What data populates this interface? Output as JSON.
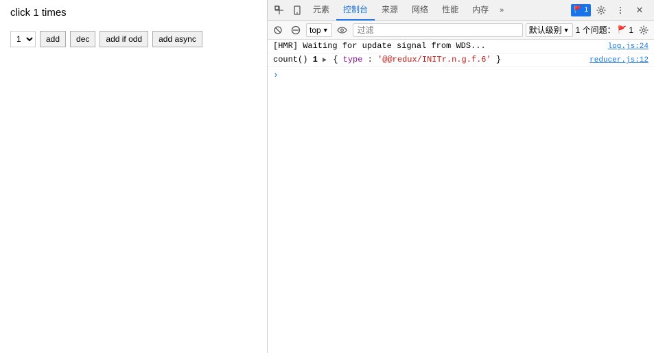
{
  "left": {
    "title": "click 1 times",
    "select_value": "1",
    "buttons": [
      {
        "label": "add",
        "name": "add-button"
      },
      {
        "label": "dec",
        "name": "dec-button"
      },
      {
        "label": "add if odd",
        "name": "add-if-odd-button"
      },
      {
        "label": "add async",
        "name": "add-async-button"
      }
    ]
  },
  "devtools": {
    "tabs": [
      {
        "label": "元素",
        "name": "tab-elements",
        "active": false
      },
      {
        "label": "控制台",
        "name": "tab-console",
        "active": true
      },
      {
        "label": "来源",
        "name": "tab-sources",
        "active": false
      },
      {
        "label": "网络",
        "name": "tab-network",
        "active": false
      },
      {
        "label": "性能",
        "name": "tab-performance",
        "active": false
      },
      {
        "label": "内存",
        "name": "tab-memory",
        "active": false
      }
    ],
    "more_label": "»",
    "badge": {
      "count": "1",
      "icon": "🔵"
    },
    "close_icon": "✕",
    "console": {
      "top_value": "top",
      "filter_placeholder": "过滤",
      "level_label": "默认级别",
      "issues_label": "1 个问题：",
      "issues_count": "1",
      "lines": [
        {
          "content": "[HMR] Waiting for update signal from WDS...",
          "source": "log.js:24",
          "type": "hmr"
        },
        {
          "content_parts": {
            "func": "count()",
            "num": "1",
            "arrow": "▶",
            "brace_open": "{",
            "key": "type",
            "colon": ":",
            "val": "'@@redux/INITr.n.g.f.6'",
            "brace_close": "}"
          },
          "source": "reducer.js:12",
          "type": "count"
        }
      ]
    }
  }
}
